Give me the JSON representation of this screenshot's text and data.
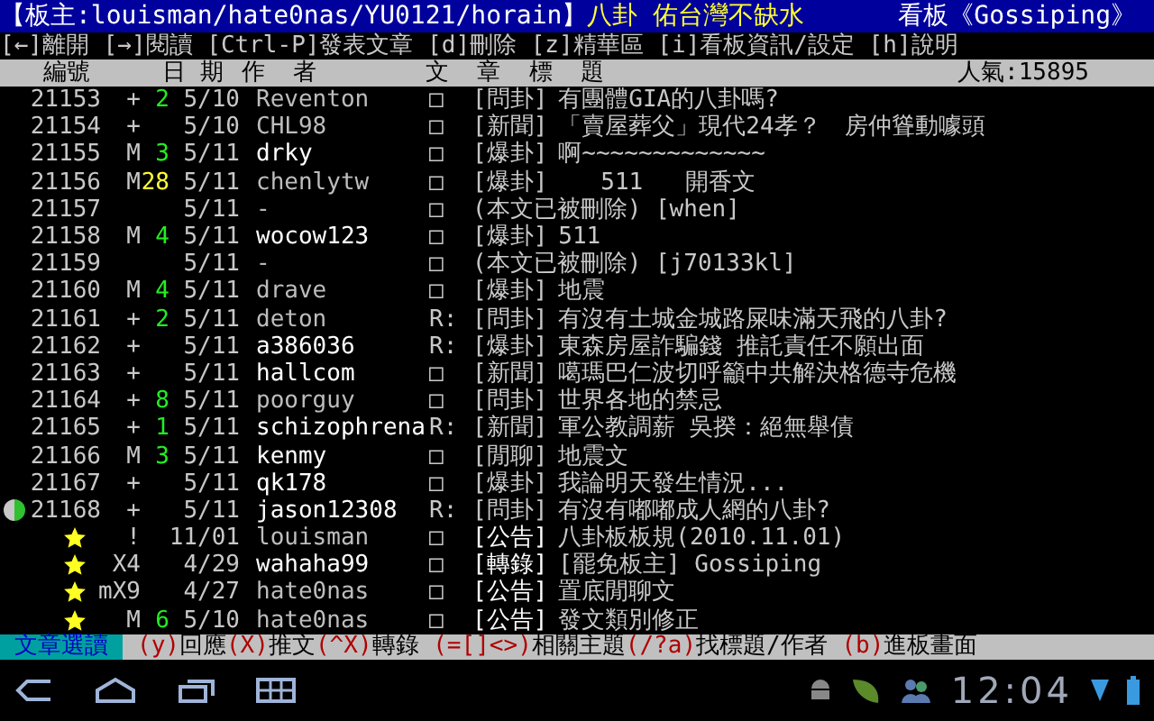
{
  "header": {
    "moderators": "【板主:louisman/hate0nas/YU0121/horain】",
    "board_title": "八卦 佑台灣不缺水",
    "board_name": "看板《Gossiping》"
  },
  "menu": "[←]離開 [→]閱讀 [Ctrl-P]發表文章 [d]刪除 [z]精華區 [i]看板資訊/設定 [h]說明",
  "columns": {
    "number": "編號",
    "date": "日 期",
    "author": "作  者",
    "title": "文  章  標  題",
    "popularity": "人氣:15895"
  },
  "rows": [
    {
      "kind": "post",
      "number": "21153",
      "mark": "+",
      "pushes": "2",
      "color": "#22ee22",
      "date": "5/10",
      "author": "Reventon",
      "highlighted": false,
      "type": "□",
      "category": "[問卦]",
      "title": "有團體GIA的八卦嗎?",
      "selected": false
    },
    {
      "kind": "post",
      "number": "21154",
      "mark": "+",
      "date": "5/10",
      "author": "CHL98",
      "highlighted": false,
      "type": "□",
      "category": "[新聞]",
      "title": "「賣屋葬父」現代24孝？　房仲聳動噱頭",
      "selected": false
    },
    {
      "kind": "post",
      "number": "21155",
      "mark": "M",
      "pushes": "3",
      "color": "#22ee22",
      "date": "5/11",
      "author": "drky",
      "highlighted": true,
      "type": "□",
      "category": "[爆卦]",
      "title": "啊~~~~~~~~~~~~~",
      "selected": false
    },
    {
      "kind": "post",
      "number": "21156",
      "mark": "M",
      "pushes": "28",
      "color": "#ffff33",
      "date": "5/11",
      "author": "chenlytw",
      "highlighted": false,
      "type": "□",
      "category": "[爆卦]",
      "title": "   511   開香文",
      "selected": false
    },
    {
      "kind": "post",
      "number": "21157",
      "date": "5/11",
      "author": "-",
      "highlighted": false,
      "type": "□",
      "title": "(本文已被刪除) [when]",
      "selected": false
    },
    {
      "kind": "post",
      "number": "21158",
      "mark": "M",
      "pushes": "4",
      "color": "#22ee22",
      "date": "5/11",
      "author": "wocow123",
      "highlighted": true,
      "type": "□",
      "category": "[爆卦]",
      "title": "511",
      "selected": false
    },
    {
      "kind": "post",
      "number": "21159",
      "date": "5/11",
      "author": "-",
      "highlighted": false,
      "type": "□",
      "title": "(本文已被刪除) [j70133kl]",
      "selected": false
    },
    {
      "kind": "post",
      "number": "21160",
      "mark": "M",
      "pushes": "4",
      "color": "#22ee22",
      "date": "5/11",
      "author": "drave",
      "highlighted": false,
      "type": "□",
      "category": "[爆卦]",
      "title": "地震",
      "selected": false
    },
    {
      "kind": "post",
      "number": "21161",
      "mark": "+",
      "pushes": "2",
      "color": "#22ee22",
      "date": "5/11",
      "author": "deton",
      "highlighted": false,
      "type": "R:",
      "category": "[問卦]",
      "title": "有沒有土城金城路屎味滿天飛的八卦?",
      "selected": false
    },
    {
      "kind": "post",
      "number": "21162",
      "mark": "+",
      "date": "5/11",
      "author": "a386036",
      "highlighted": true,
      "type": "R:",
      "category": "[爆卦]",
      "title": "東森房屋詐騙錢 推託責任不願出面",
      "selected": false
    },
    {
      "kind": "post",
      "number": "21163",
      "mark": "+",
      "date": "5/11",
      "author": "hallcom",
      "highlighted": true,
      "type": "□",
      "category": "[新聞]",
      "title": "噶瑪巴仁波切呼籲中共解決格德寺危機",
      "selected": false
    },
    {
      "kind": "post",
      "number": "21164",
      "mark": "+",
      "pushes": "8",
      "color": "#22ee22",
      "date": "5/11",
      "author": "poorguy",
      "highlighted": false,
      "type": "□",
      "category": "[問卦]",
      "title": "世界各地的禁忌",
      "selected": false
    },
    {
      "kind": "post",
      "number": "21165",
      "mark": "+",
      "pushes": "1",
      "color": "#22ee22",
      "date": "5/11",
      "author": "schizophrena",
      "highlighted": true,
      "type": "R:",
      "category": "[新聞]",
      "title": "軍公教調薪 吳揆：絕無舉債",
      "selected": false
    },
    {
      "kind": "post",
      "number": "21166",
      "mark": "M",
      "pushes": "3",
      "color": "#22ee22",
      "date": "5/11",
      "author": "kenmy",
      "highlighted": true,
      "type": "□",
      "category": "[閒聊]",
      "title": "地震文",
      "selected": false
    },
    {
      "kind": "post",
      "number": "21167",
      "mark": "+",
      "date": "5/11",
      "author": "qk178",
      "highlighted": true,
      "type": "□",
      "category": "[爆卦]",
      "title": "我論明天發生情況...",
      "selected": false
    },
    {
      "kind": "post",
      "number": "21168",
      "mark": "+",
      "date": "5/11",
      "author": "jason12308",
      "highlighted": true,
      "type": "R:",
      "category": "[問卦]",
      "title": "有沒有嘟嘟成人網的八卦?",
      "selected": true
    },
    {
      "kind": "pinned",
      "mark": "!",
      "date": "11/01",
      "author": "louisman",
      "highlighted": false,
      "type": "□",
      "category": "[公告]",
      "title": "八卦板板規(2010.11.01)",
      "selected": false
    },
    {
      "kind": "pinned",
      "mark": "X4",
      "date": "4/29",
      "author": "wahaha99",
      "highlighted": true,
      "type": "□",
      "category": "[轉錄]",
      "title": "[罷免板主] Gossiping",
      "selected": false
    },
    {
      "kind": "pinned",
      "mark": "mX9",
      "date": "4/27",
      "author": "hate0nas",
      "highlighted": false,
      "type": "□",
      "category": "[公告]",
      "title": "置底閒聊文",
      "selected": false
    },
    {
      "kind": "pinned",
      "mark": "M",
      "pushes": "6",
      "color": "#22ee22",
      "date": "5/10",
      "author": "hate0nas",
      "highlighted": false,
      "type": "□",
      "category": "[公告]",
      "title": "發文類別修正",
      "selected": false
    }
  ],
  "footer": {
    "mode": "文章選讀",
    "keys": [
      {
        "key": "(y)",
        "label": "回應"
      },
      {
        "key": "(X)",
        "label": "推文"
      },
      {
        "key": "(^X)",
        "label": "轉錄 "
      },
      {
        "key": "(=[]<>)",
        "label": "相關主題"
      },
      {
        "key": "(/?a)",
        "label": "找標題/作者 "
      },
      {
        "key": "(b)",
        "label": "進板畫面"
      }
    ]
  },
  "system_bar": {
    "time": "12:04"
  }
}
